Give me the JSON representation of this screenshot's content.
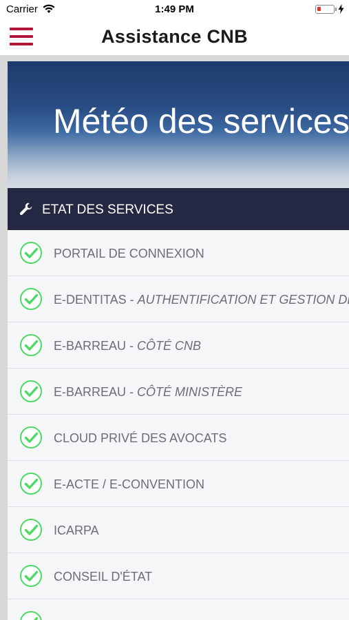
{
  "status_bar": {
    "carrier": "Carrier",
    "time": "1:49 PM",
    "battery_color": "#e8322e"
  },
  "nav": {
    "title": "Assistance CNB",
    "menu_icon": "hamburger-menu-icon",
    "accent_color": "#b1163a"
  },
  "hero": {
    "title": "Météo des services"
  },
  "section": {
    "icon": "wrench-icon",
    "label": "ETAT DES SERVICES",
    "background": "#252842"
  },
  "services": [
    {
      "name": "PORTAIL DE CONNEXION",
      "separator": "",
      "sub": "",
      "status_icon": "check-circle-icon"
    },
    {
      "name": "E-DENTITAS",
      "separator": " - ",
      "sub": "AUTHENTIFICATION ET GESTION DES D",
      "status_icon": "check-circle-icon"
    },
    {
      "name": "E-BARREAU",
      "separator": " - ",
      "sub": "CÔTÉ CNB",
      "status_icon": "check-circle-icon"
    },
    {
      "name": "E-BARREAU",
      "separator": " - ",
      "sub": "CÔTÉ MINISTÈRE",
      "status_icon": "check-circle-icon"
    },
    {
      "name": "CLOUD PRIVÉ DES AVOCATS",
      "separator": "",
      "sub": "",
      "status_icon": "check-circle-icon"
    },
    {
      "name": "E-ACTE / E-CONVENTION",
      "separator": "",
      "sub": "",
      "status_icon": "check-circle-icon"
    },
    {
      "name": "ICARPA",
      "separator": "",
      "sub": "",
      "status_icon": "check-circle-icon"
    },
    {
      "name": "CONSEIL D'ÉTAT",
      "separator": "",
      "sub": "",
      "status_icon": "check-circle-icon"
    },
    {
      "name": "",
      "separator": "",
      "sub": "",
      "status_icon": "check-circle-icon"
    }
  ],
  "status_ok_color": "#4cd964"
}
